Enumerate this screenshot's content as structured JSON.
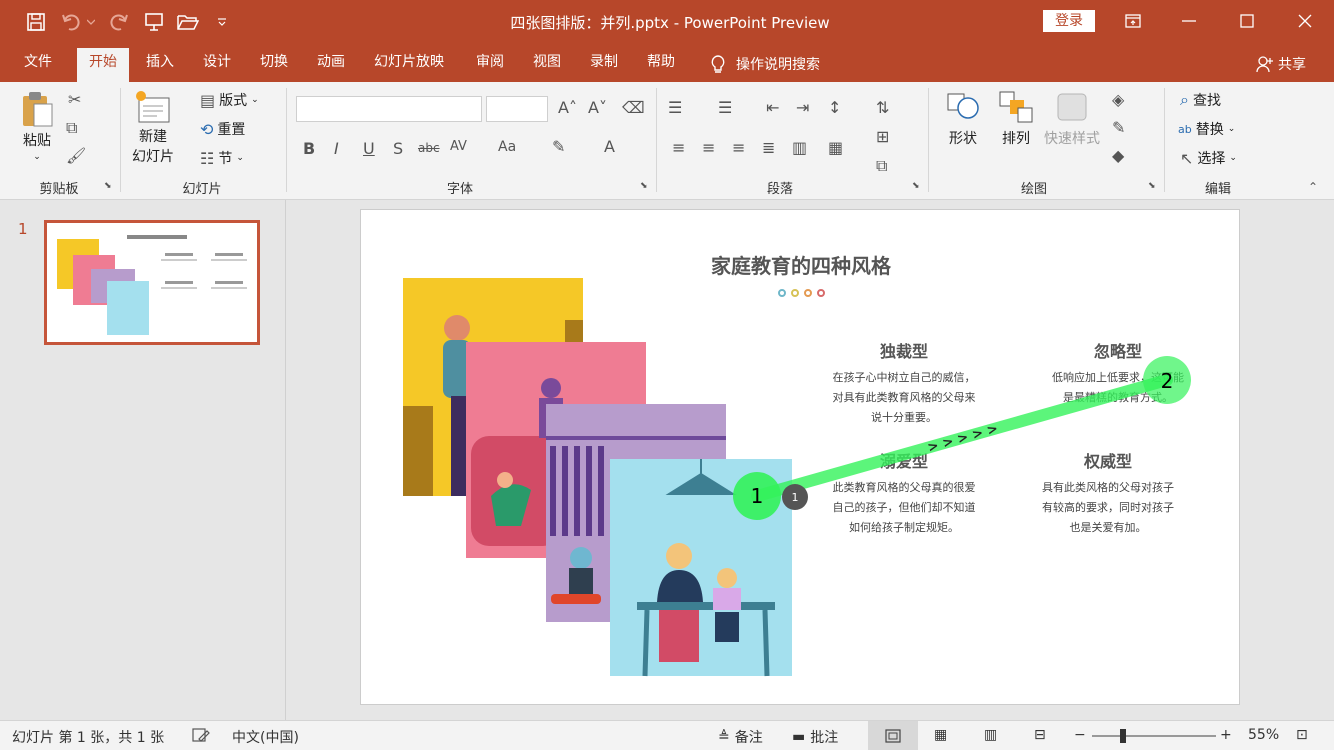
{
  "window": {
    "title": "四张图排版：并列.pptx  -  PowerPoint Preview",
    "login": "登录"
  },
  "tabs": [
    "文件",
    "开始",
    "插入",
    "设计",
    "切换",
    "动画",
    "幻灯片放映",
    "审阅",
    "视图",
    "录制",
    "帮助"
  ],
  "search_hint": "操作说明搜索",
  "share": "共享",
  "ribbon": {
    "clipboard": {
      "paste": "粘贴",
      "label": "剪贴板"
    },
    "slides": {
      "new_line1": "新建",
      "new_line2": "幻灯片",
      "layout": "版式",
      "reset": "重置",
      "section": "节",
      "label": "幻灯片"
    },
    "font": {
      "label": "字体"
    },
    "paragraph": {
      "label": "段落"
    },
    "drawing": {
      "shapes": "形状",
      "arrange": "排列",
      "quick_styles": "快速样式",
      "label": "绘图"
    },
    "editing": {
      "find": "查找",
      "replace": "替换",
      "select": "选择",
      "label": "编辑"
    }
  },
  "slide_panel": {
    "number": "1"
  },
  "slide": {
    "title": "家庭教育的四种风格",
    "cards": [
      {
        "title": "独裁型",
        "text": "在孩子心中树立自己的威信，对具有此类教育风格的父母来说十分重要。"
      },
      {
        "title": "忽略型",
        "text": "低响应加上低要求，这可能是最糟糕的教育方式。"
      },
      {
        "title": "溺爱型",
        "text": "此类教育风格的父母真的很爱自己的孩子，但他们却不知道如何给孩子制定规矩。"
      },
      {
        "title": "权威型",
        "text": "具有此类风格的父母对孩子有较高的要求，同时对孩子也是关爱有加。"
      }
    ],
    "marker_1": "1",
    "marker_2": "2",
    "marker_small": "1",
    "arrows": "> > > > >"
  },
  "status": {
    "slide_info": "幻灯片 第 1 张，共 1 张",
    "language": "中文(中国)",
    "notes": "备注",
    "comments": "批注",
    "zoom": "55%"
  },
  "colors": {
    "accent": "#b7472a",
    "yellow": "#f5c827",
    "pink": "#ef7c93",
    "purple": "#b79ccc",
    "blue": "#a4e0ee"
  }
}
